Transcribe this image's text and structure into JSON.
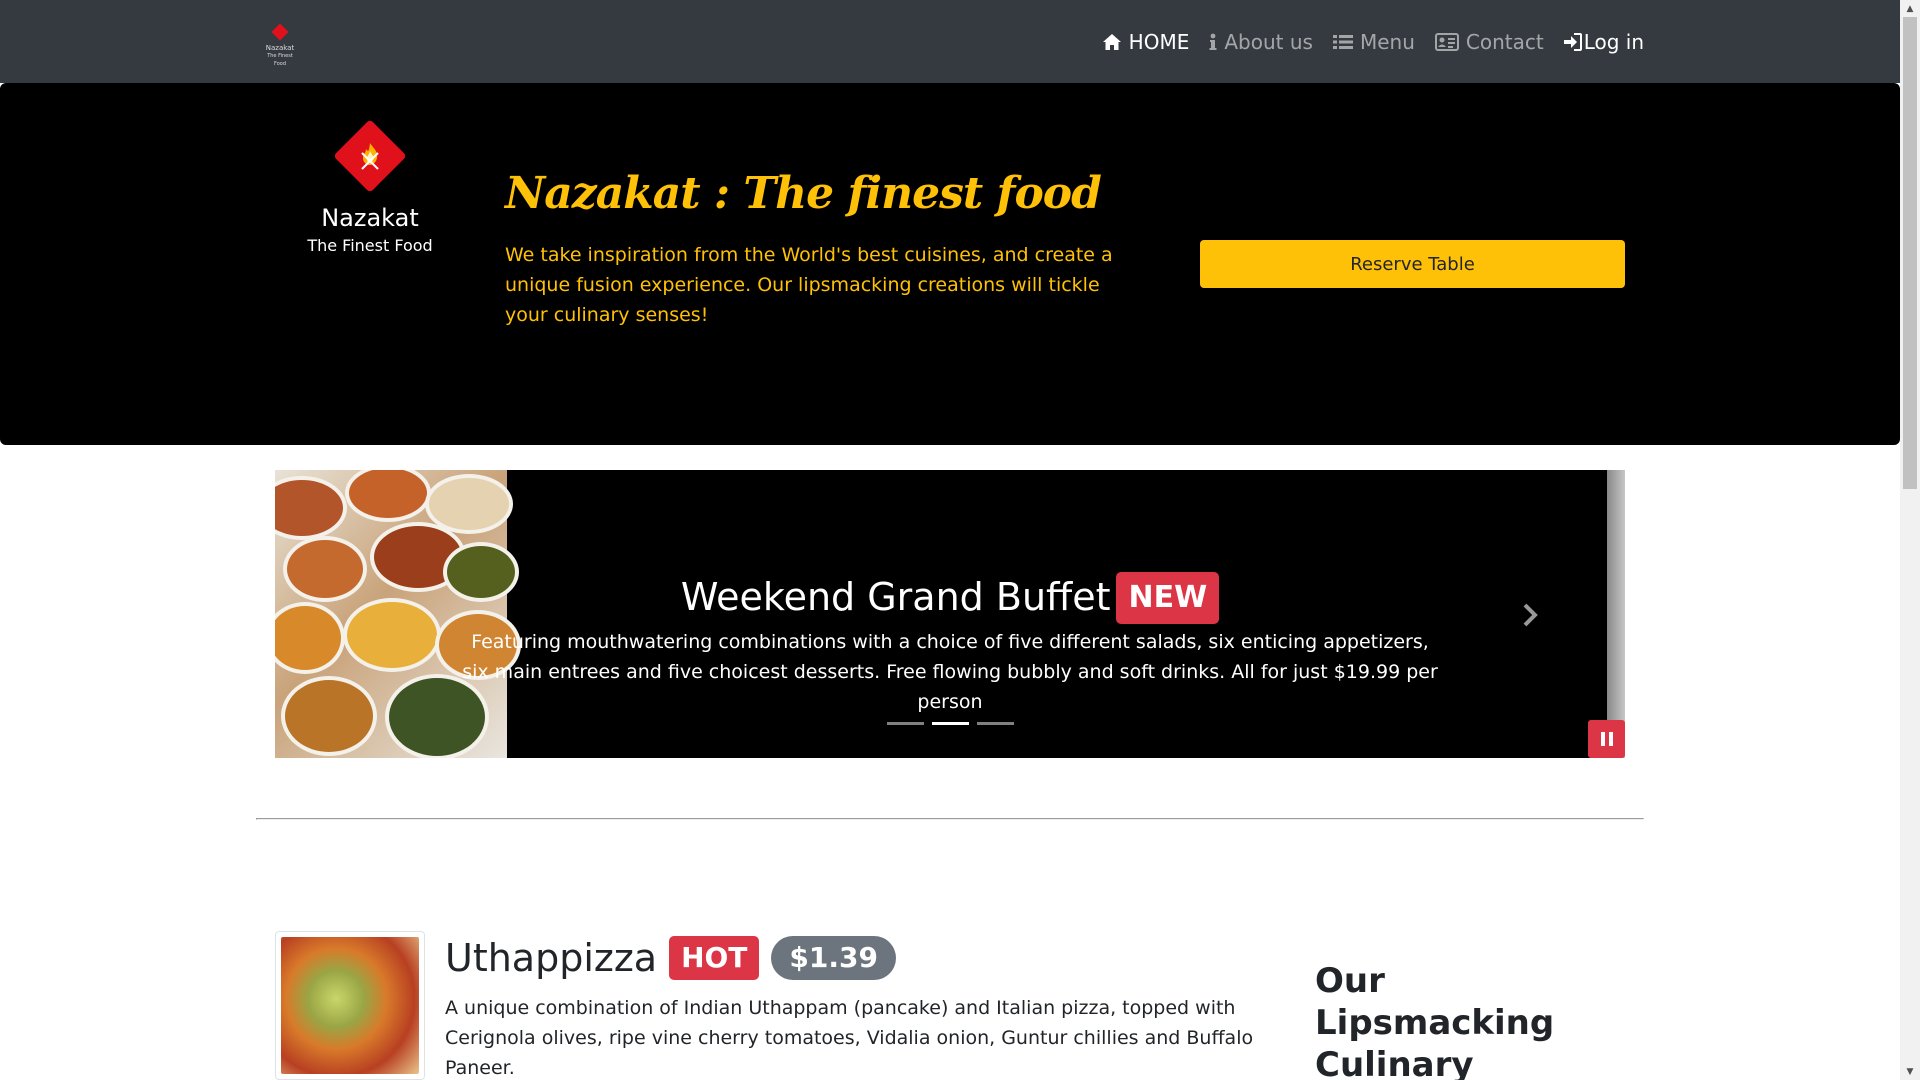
{
  "navbar": {
    "logo_text": "Nazakat",
    "logo_subtext": "The Finest Food",
    "links": [
      {
        "label": "HOME",
        "icon": "home-icon",
        "active": true
      },
      {
        "label": "About us",
        "icon": "info-icon",
        "active": false
      },
      {
        "label": "Menu",
        "icon": "list-icon",
        "active": false
      },
      {
        "label": "Contact",
        "icon": "address-card-icon",
        "active": false
      },
      {
        "label": "Log in",
        "icon": "sign-in-icon",
        "active": false
      }
    ]
  },
  "jumbotron": {
    "brand_name": "Nazakat",
    "brand_tagline": "The Finest Food",
    "title": "Nazakat : The finest food",
    "description": "We take inspiration from the World's best cuisines, and create a unique fusion experience. Our lipsmacking creations will tickle your culinary senses!",
    "reserve_label": "Reserve Table"
  },
  "carousel": {
    "slide_title": "Weekend Grand Buffet",
    "slide_badge": "NEW",
    "slide_description": "Featuring mouthwatering combinations with a choice of five different salads, six enticing appetizers, six main entrees and five choicest desserts. Free flowing bubbly and soft drinks. All for just $19.99 per person",
    "indicator_count": 3,
    "active_indicator": 2
  },
  "featured_dish": {
    "name": "Uthappizza",
    "badge": "HOT",
    "price": "$1.39",
    "description": "A unique combination of Indian Uthappam (pancake) and Italian pizza, topped with Cerignola olives, ripe vine cherry tomatoes, Vidalia onion, Guntur chillies and Buffalo Paneer."
  },
  "sidebar": {
    "heading": "Our Lipsmacking Culinary Creations"
  },
  "colors": {
    "navbar_bg": "#343a40",
    "accent_yellow": "#ffc107",
    "danger_red": "#dc3545",
    "secondary_gray": "#6c757d",
    "logo_red": "#e0111b"
  }
}
